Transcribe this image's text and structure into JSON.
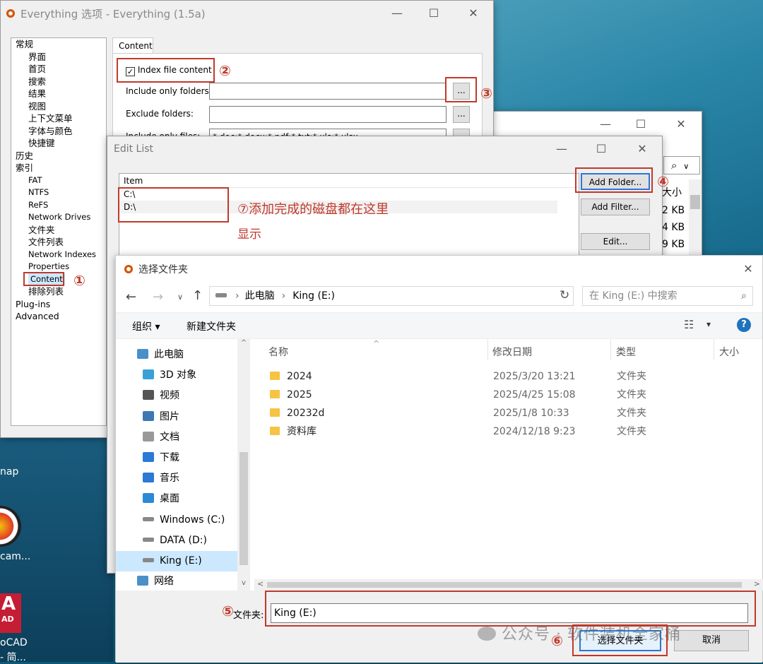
{
  "desktop": {
    "labels": [
      "nap",
      "cam...",
      "oCAD",
      "- 简..."
    ],
    "icon_badge": "AD",
    "sq_a": "A"
  },
  "options": {
    "title": "Everything 选项 - Everything (1.5a)",
    "minimize": "—",
    "maximize": "☐",
    "close": "✕",
    "tree": [
      {
        "label": "常规",
        "level": 0
      },
      {
        "label": "界面",
        "level": 1
      },
      {
        "label": "首页",
        "level": 1
      },
      {
        "label": "搜索",
        "level": 1
      },
      {
        "label": "结果",
        "level": 1
      },
      {
        "label": "视图",
        "level": 1
      },
      {
        "label": "上下文菜单",
        "level": 1
      },
      {
        "label": "字体与颜色",
        "level": 1
      },
      {
        "label": "快捷键",
        "level": 1
      },
      {
        "label": "历史",
        "level": 0
      },
      {
        "label": "索引",
        "level": 0
      },
      {
        "label": "FAT",
        "level": 1
      },
      {
        "label": "NTFS",
        "level": 1
      },
      {
        "label": "ReFS",
        "level": 1
      },
      {
        "label": "Network Drives",
        "level": 1
      },
      {
        "label": "文件夹",
        "level": 1
      },
      {
        "label": "文件列表",
        "level": 1
      },
      {
        "label": "Network Indexes",
        "level": 1
      },
      {
        "label": "Properties",
        "level": 1
      },
      {
        "label": "Content",
        "level": 1,
        "selected": true
      },
      {
        "label": "排除列表",
        "level": 1
      },
      {
        "label": "Plug-ins",
        "level": 0
      },
      {
        "label": "Advanced",
        "level": 0
      }
    ],
    "tab": "Content",
    "index_label": "Index file content",
    "include_folders_label": "Include only folders:",
    "exclude_folders_label": "Exclude folders:",
    "include_files_label": "Include only files:",
    "include_files_value": "*.doc;*.docx;*.pdf;*.txt;*.xls;*.xlsx",
    "browse": "..."
  },
  "mainwin": {
    "minimize": "—",
    "maximize": "☐",
    "close": "✕",
    "search_icon": "⌕",
    "dropdown": "∨",
    "size_header": "大小",
    "sizes": [
      "2 KB",
      "4 KB",
      "9 KB"
    ]
  },
  "editlist": {
    "title": "Edit List",
    "minimize": "—",
    "maximize": "☐",
    "close": "✕",
    "column": "Item",
    "items": [
      "C:\\",
      "D:\\"
    ],
    "add_folder": "Add Folder...",
    "add_filter": "Add Filter...",
    "edit": "Edit..."
  },
  "annotations": {
    "n1": "①",
    "n2": "②",
    "n3": "③",
    "n4": "④",
    "n5": "⑤",
    "n6": "⑥",
    "n7_note_line1": "⑦添加完成的磁盘都在这里",
    "n7_note_line2": "显示"
  },
  "picker": {
    "title": "选择文件夹",
    "close": "✕",
    "back": "←",
    "forward": "→",
    "recent": "∨",
    "up": "↑",
    "crumbs": [
      "此电脑",
      "King (E:)"
    ],
    "crumb_sep": "›",
    "refresh": "↻",
    "search_placeholder": "在 King (E:) 中搜索",
    "organize": "组织 ▾",
    "new_folder": "新建文件夹",
    "view_icon": "☷",
    "view_dropdown": "▾",
    "help": "?",
    "nav": [
      {
        "label": "此电脑",
        "icon": "pc",
        "level": 0
      },
      {
        "label": "3D 对象",
        "icon": "3d",
        "level": 1
      },
      {
        "label": "视频",
        "icon": "video",
        "level": 1
      },
      {
        "label": "图片",
        "icon": "pictures",
        "level": 1
      },
      {
        "label": "文档",
        "icon": "document",
        "level": 1
      },
      {
        "label": "下载",
        "icon": "download",
        "level": 1
      },
      {
        "label": "音乐",
        "icon": "music",
        "level": 1
      },
      {
        "label": "桌面",
        "icon": "desktop",
        "level": 1
      },
      {
        "label": "Windows (C:)",
        "icon": "drive",
        "level": 1
      },
      {
        "label": "DATA (D:)",
        "icon": "drive",
        "level": 1
      },
      {
        "label": "King (E:)",
        "icon": "drive",
        "level": 1,
        "selected": true
      },
      {
        "label": "网络",
        "icon": "network",
        "level": 0
      }
    ],
    "columns": [
      "名称",
      "修改日期",
      "类型",
      "大小"
    ],
    "rows": [
      {
        "name": "2024",
        "date": "2025/3/20 13:21",
        "type": "文件夹"
      },
      {
        "name": "2025",
        "date": "2025/4/25 15:08",
        "type": "文件夹"
      },
      {
        "name": "20232d",
        "date": "2025/1/8 10:33",
        "type": "文件夹"
      },
      {
        "name": "资料库",
        "date": "2024/12/18 9:23",
        "type": "文件夹"
      }
    ],
    "folder_label": "文件夹:",
    "folder_value": "King (E:)",
    "select_button": "选择文件夹",
    "cancel_button": "取消",
    "scroll_up": "^",
    "scroll_down": "v",
    "scroll_left": "<",
    "scroll_right": ">"
  },
  "watermark": "公众号 · 软件装机全家桶",
  "colors": {
    "annotation": "#c0392b",
    "selection": "#cce8ff",
    "help": "#1e73be"
  }
}
